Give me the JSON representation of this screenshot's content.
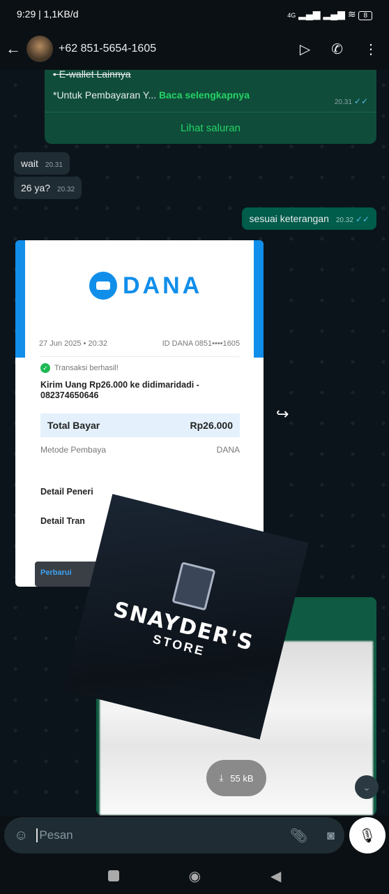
{
  "status": {
    "time_speed": "9:29 | 1,1KB/d",
    "network": "4G",
    "battery": "8"
  },
  "header": {
    "contact": "+62 851-5654-1605"
  },
  "channel_msg": {
    "bullet": "E-wallet Lainnya",
    "text": "*Untuk Pembayaran Y...",
    "read_more": "Baca selengkapnya",
    "time": "20.31",
    "action": "Lihat saluran"
  },
  "messages": [
    {
      "text": "wait",
      "time": "20.31",
      "dir": "in"
    },
    {
      "text": "26 ya?",
      "time": "20.32",
      "dir": "in"
    },
    {
      "text": "sesuai keterangan",
      "time": "20.32",
      "dir": "out"
    }
  ],
  "receipt": {
    "brand": "DANA",
    "date": "27 Jun 2025 • 20:32",
    "id": "ID DANA 0851••••1605",
    "status": "Transaksi berhasil!",
    "desc": "Kirim Uang Rp26.000 ke didimaridadi - 082374650646",
    "total_label": "Total Bayar",
    "total": "Rp26.000",
    "method_label": "Metode Pembaya",
    "method_value": "DANA",
    "detail1": "Detail Peneri",
    "detail2": "Detail Tran",
    "button": "Perbarui"
  },
  "sticker": {
    "line1": "SNAYDER'S",
    "line2": "STORE"
  },
  "download": {
    "size": "55 kB"
  },
  "input": {
    "placeholder": "Pesan"
  },
  "colors": {
    "accent": "#25d366",
    "outgoing": "#005c4b",
    "dana": "#118eea"
  }
}
